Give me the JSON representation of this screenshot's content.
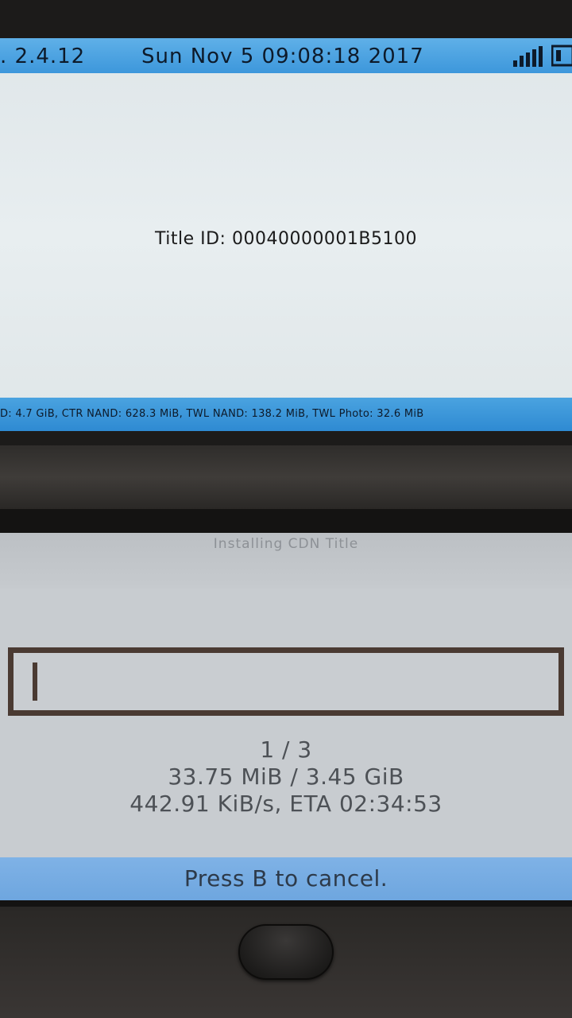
{
  "top_screen": {
    "version": ". 2.4.12",
    "datetime": "Sun Nov  5 09:08:18 2017",
    "title_id": "Title ID: 00040000001B5100",
    "storage_info": "D: 4.7 GiB, CTR NAND: 628.3 MiB, TWL NAND: 138.2 MiB, TWL Photo: 32.6 MiB",
    "signal_icon": "signal-bars-icon",
    "battery_icon": "battery-icon"
  },
  "bottom_screen": {
    "title": "Installing CDN Title",
    "progress": {
      "fraction": 0.01
    },
    "count": "1 / 3",
    "size": "33.75 MiB / 3.45 GiB",
    "speed": "442.91 KiB/s, ETA 02:34:53",
    "cancel_hint": "Press B to cancel."
  },
  "colors": {
    "status_bar": "#3d97db",
    "top_bg": "#e3eaec",
    "bottom_bg": "#c8ccd0",
    "progress_border": "#4a3a32",
    "footer_bar": "#74aae2"
  }
}
